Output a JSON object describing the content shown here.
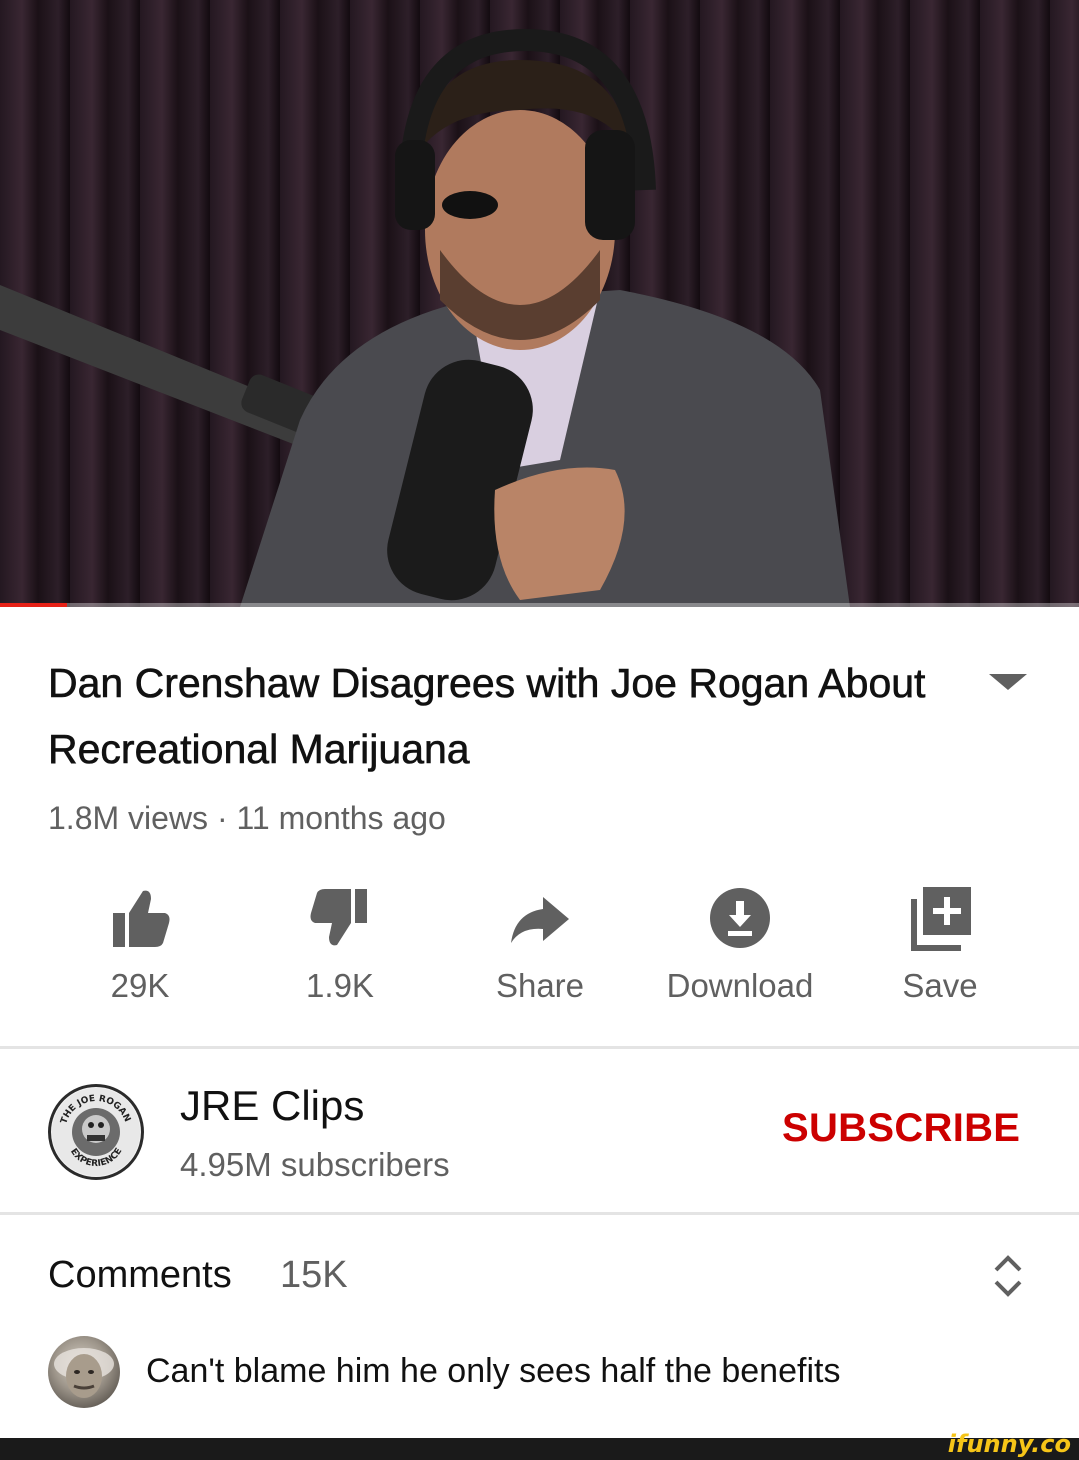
{
  "video": {
    "progress_fraction": 0.062,
    "progress_color": "#e62117"
  },
  "title": "Dan Crenshaw Disagrees with Joe Rogan About Recreational Marijuana",
  "meta": "1.8M views · 11 months ago",
  "actions": [
    {
      "icon": "thumbs-up-icon",
      "label": "29K"
    },
    {
      "icon": "thumbs-down-icon",
      "label": "1.9K"
    },
    {
      "icon": "share-icon",
      "label": "Share"
    },
    {
      "icon": "download-icon",
      "label": "Download"
    },
    {
      "icon": "add-to-playlist-icon",
      "label": "Save"
    }
  ],
  "channel": {
    "name": "JRE Clips",
    "subscribers": "4.95M subscribers",
    "subscribe_label": "SUBSCRIBE",
    "subscribe_color": "#cc0000",
    "avatar_text": "THE JOE ROGAN EXPERIENCE"
  },
  "comments": {
    "label": "Comments",
    "count": "15K",
    "top_comment": "Can't blame him he only sees half the benefits"
  },
  "watermark": "ifunny.co"
}
